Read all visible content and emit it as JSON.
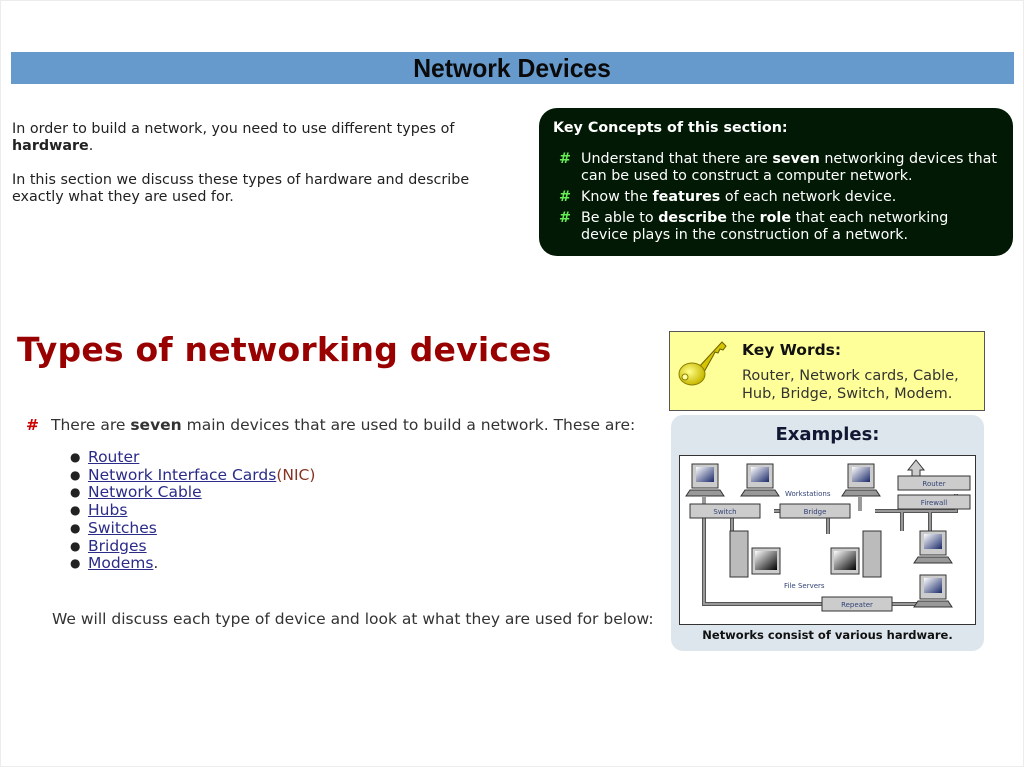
{
  "header": {
    "title": "Network Devices"
  },
  "intro": {
    "p1_text": "In order to build a network, you need to use different types of ",
    "p1_bold": "hardware",
    "p1_end": ".",
    "p2": "In this section we discuss these types of hardware and describe exactly what they are used for."
  },
  "key_concepts": {
    "title": "Key Concepts of this section:",
    "bullet_icon": "#",
    "items": [
      {
        "a": "Understand that there are ",
        "b": "seven",
        "c": " networking devices that can be used to construct a computer network.",
        "d": "",
        "e": ""
      },
      {
        "a": "Know the ",
        "b": "features",
        "c": " of each network device.",
        "d": "",
        "e": ""
      },
      {
        "a": "Be able to ",
        "b": "describe",
        "c": " the ",
        "d": "role",
        "e": " that each networking device plays in the construction of a network."
      }
    ]
  },
  "types": {
    "title": "Types of networking devices",
    "bullet_icon": "#",
    "lead_a": "There are ",
    "lead_b": "seven",
    "lead_c": " main devices that are used to build a network. These are:",
    "devices": [
      {
        "link": "Router",
        "suffix": "",
        "tail": ""
      },
      {
        "link": "Network Interface Cards",
        "suffix": " (NIC)",
        "tail": ""
      },
      {
        "link": "Network Cable",
        "suffix": "",
        "tail": ""
      },
      {
        "link": "Hubs",
        "suffix": "",
        "tail": ""
      },
      {
        "link": "Switches",
        "suffix": "",
        "tail": ""
      },
      {
        "link": "Bridges",
        "suffix": "",
        "tail": ""
      },
      {
        "link": "Modems",
        "suffix": "",
        "tail": "."
      }
    ],
    "outro": "We will discuss each type of device and look at what they are used for below:"
  },
  "key_words": {
    "icon": "key-icon",
    "title": "Key Words:",
    "body": "Router, Network cards, Cable, Hub, Bridge, Switch, Modem."
  },
  "examples": {
    "title": "Examples:",
    "caption": "Networks consist of various hardware.",
    "diagram_labels": {
      "switch": "Switch",
      "bridge": "Bridge",
      "workstations": "Workstations",
      "router": "Router",
      "firewall": "Firewall",
      "file_servers": "File Servers",
      "repeater": "Repeater"
    }
  }
}
